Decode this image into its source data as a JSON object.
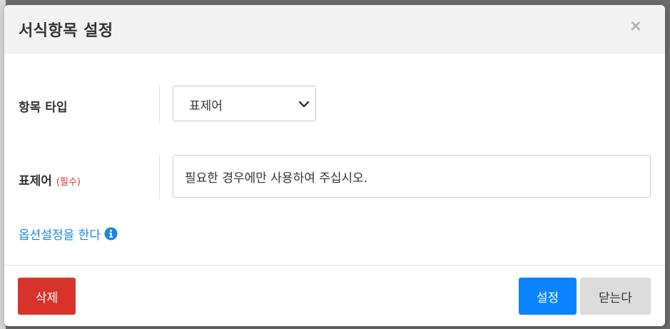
{
  "dialog": {
    "title": "서식항목 설정",
    "close_symbol": "×"
  },
  "form": {
    "item_type": {
      "label": "항목 타입",
      "selected_value": "표제어",
      "icon": "chevron-down-icon"
    },
    "title_field": {
      "label": "표제어",
      "required_tag": "(필수)",
      "value": "필요한 경우에만 사용하여 주십시오."
    },
    "option_link": {
      "label": "옵션설정을 한다",
      "icon": "info-circle-icon"
    }
  },
  "footer": {
    "delete_label": "삭제",
    "apply_label": "설정",
    "close_label": "닫는다"
  },
  "colors": {
    "danger": "#d9342b",
    "primary": "#0a84ff",
    "link": "#1a88d8",
    "secondary": "#dcdcdc"
  }
}
